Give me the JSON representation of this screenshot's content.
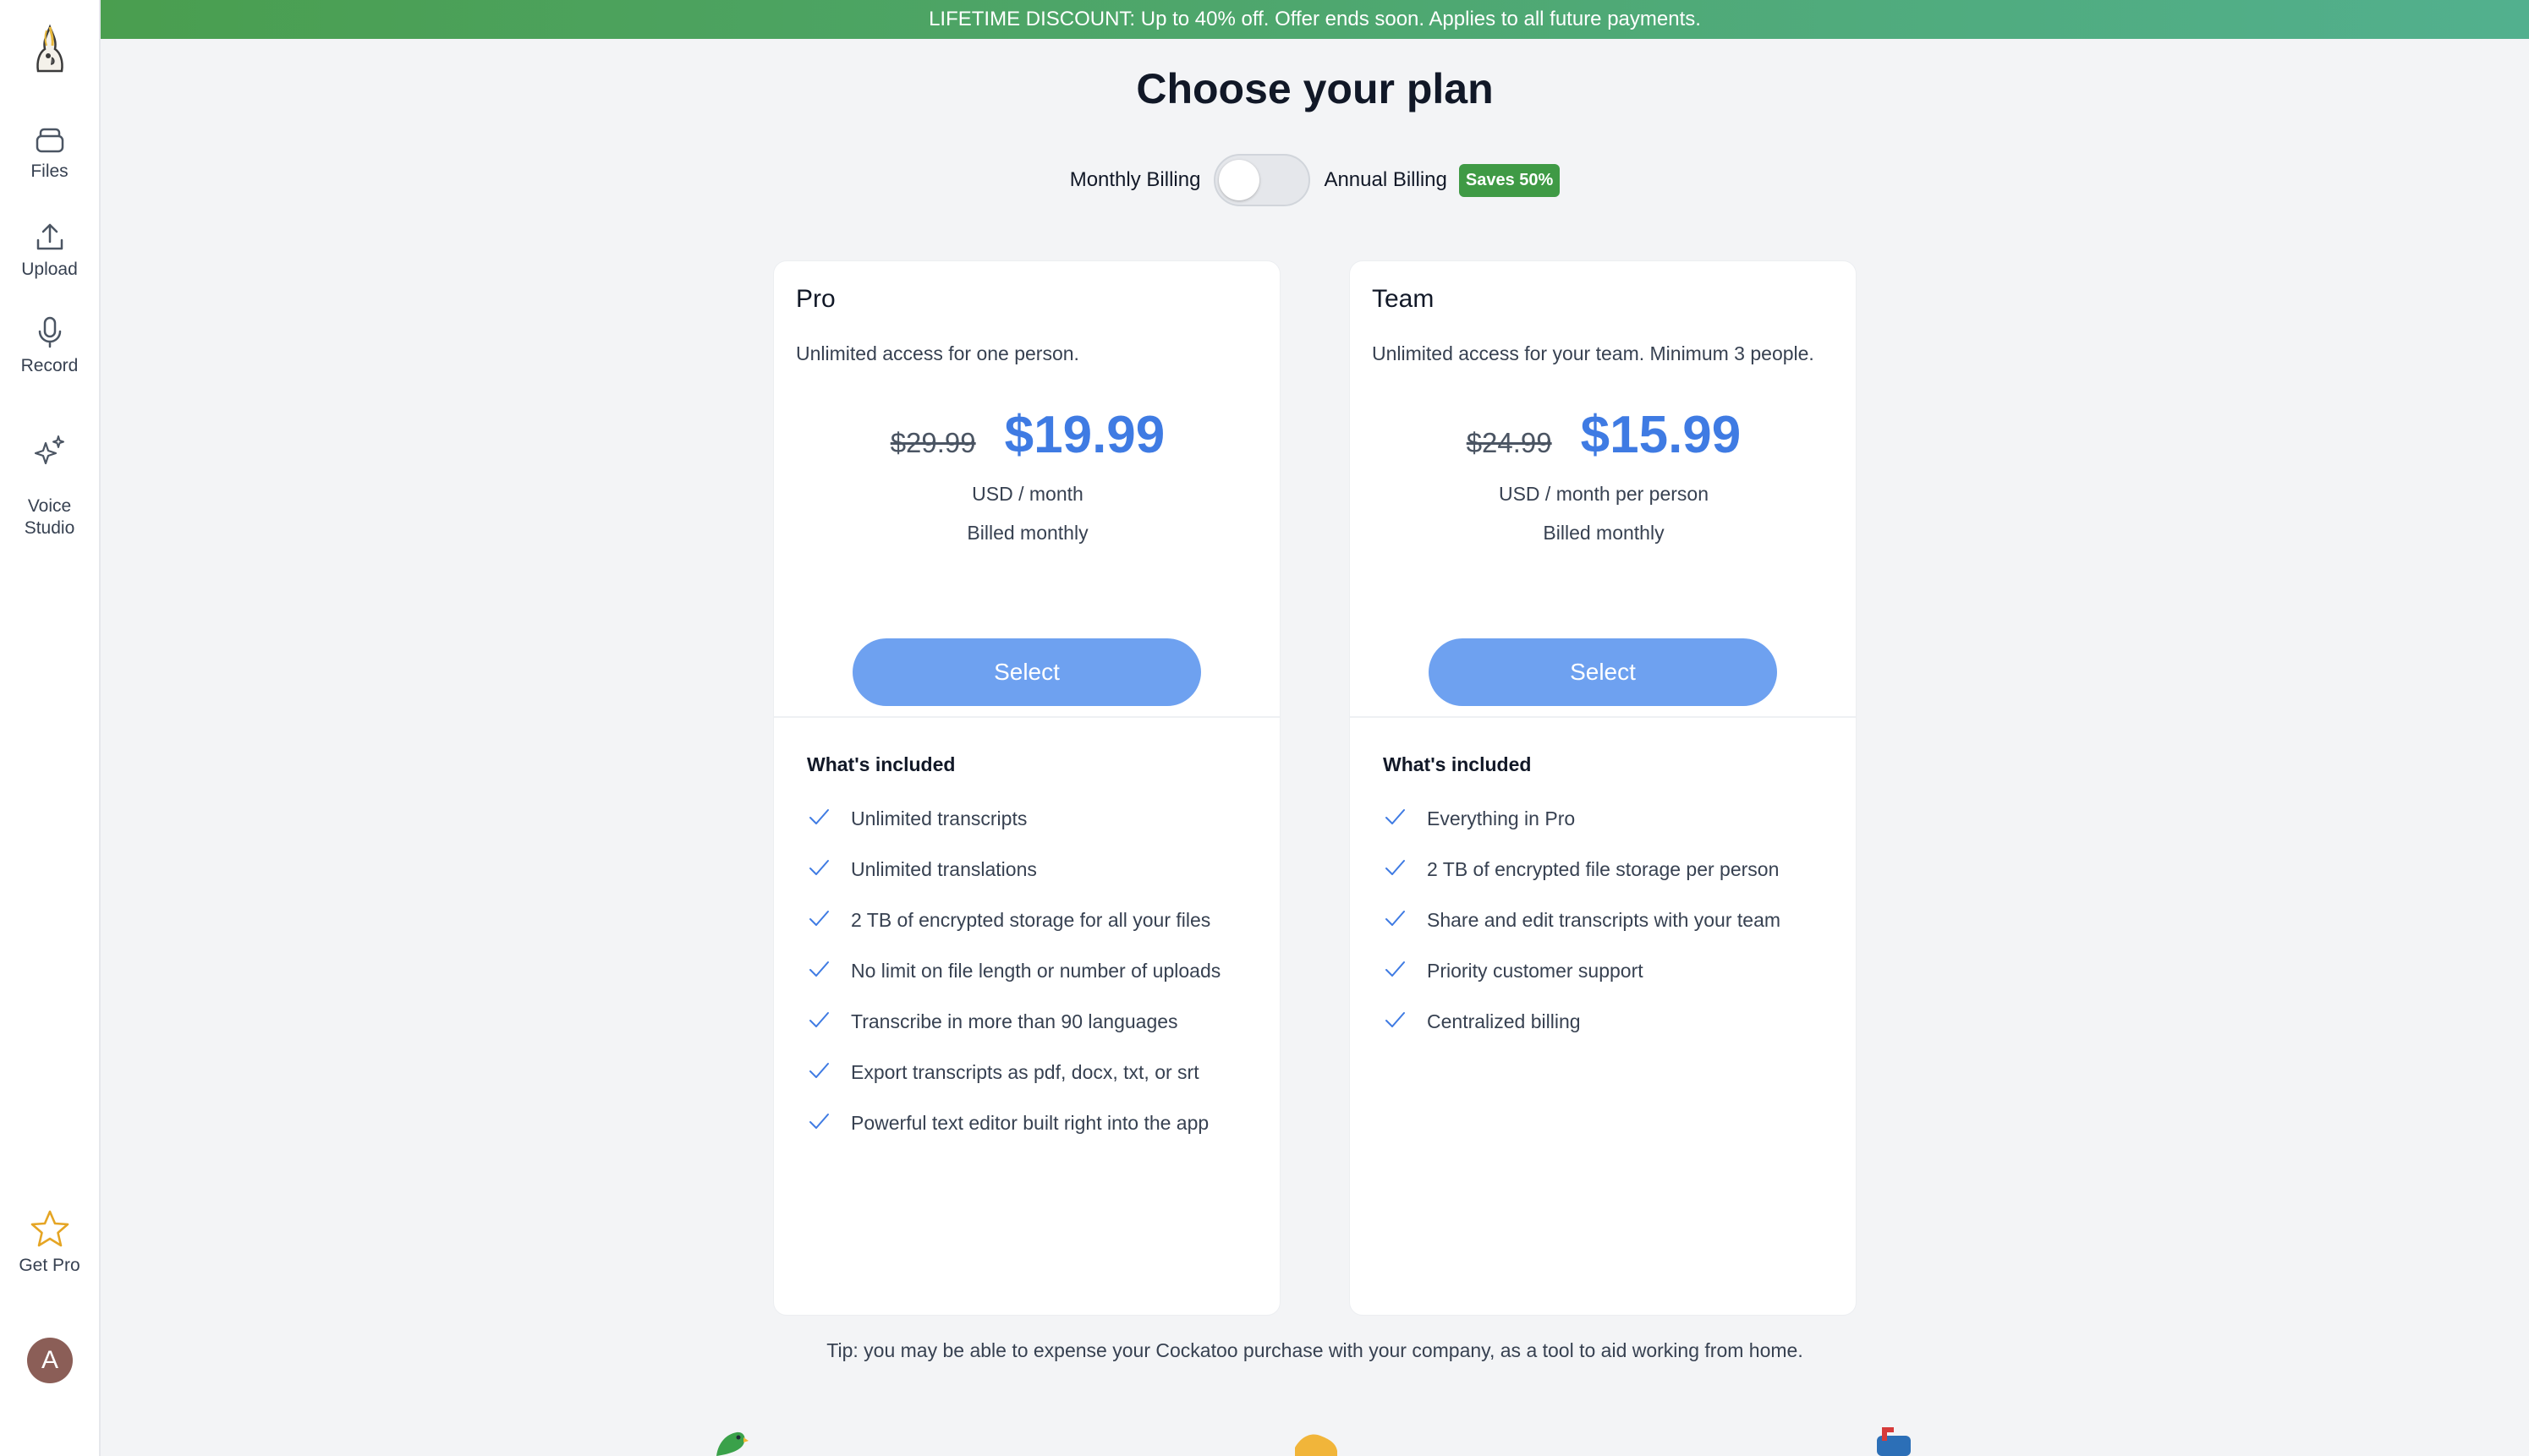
{
  "sidebar": {
    "items": [
      {
        "label": "Files",
        "icon": "files-icon"
      },
      {
        "label": "Upload",
        "icon": "upload-icon"
      },
      {
        "label": "Record",
        "icon": "microphone-icon"
      },
      {
        "label": "Voice\nStudio",
        "icon": "sparkles-icon"
      }
    ],
    "get_pro": {
      "label": "Get Pro",
      "icon": "star-icon"
    },
    "avatar_initial": "A"
  },
  "banner": {
    "text": "LIFETIME DISCOUNT: Up to 40% off. Offer ends soon. Applies to all future payments."
  },
  "page": {
    "title": "Choose your plan",
    "billing": {
      "monthly_label": "Monthly Billing",
      "annual_label": "Annual Billing",
      "save_badge": "Saves 50%",
      "annual_selected": false
    },
    "tip": "Tip: you may be able to expense your Cockatoo purchase with your company, as a tool to aid working from home."
  },
  "plans": [
    {
      "name": "Pro",
      "description": "Unlimited access for one person.",
      "old_price": "$29.99",
      "price": "$19.99",
      "unit": "USD / month",
      "billed": "Billed monthly",
      "button": "Select",
      "included_title": "What's included",
      "features": [
        "Unlimited transcripts",
        "Unlimited translations",
        "2 TB of encrypted storage for all your files",
        "No limit on file length or number of uploads",
        "Transcribe in more than 90 languages",
        "Export transcripts as pdf, docx, txt, or srt",
        "Powerful text editor built right into the app"
      ]
    },
    {
      "name": "Team",
      "description": "Unlimited access for your team. Minimum 3 people.",
      "old_price": "$24.99",
      "price": "$15.99",
      "unit": "USD / month per person",
      "billed": "Billed monthly",
      "button": "Select",
      "included_title": "What's included",
      "features": [
        "Everything in Pro",
        "2 TB of encrypted file storage per person",
        "Share and edit transcripts with your team",
        "Priority customer support",
        "Centralized billing"
      ]
    }
  ],
  "colors": {
    "accent": "#3f7be3",
    "button": "#6ea1f0",
    "badge": "#3f9a45",
    "banner_start": "#4a9e4f",
    "banner_end": "#52b08e"
  }
}
